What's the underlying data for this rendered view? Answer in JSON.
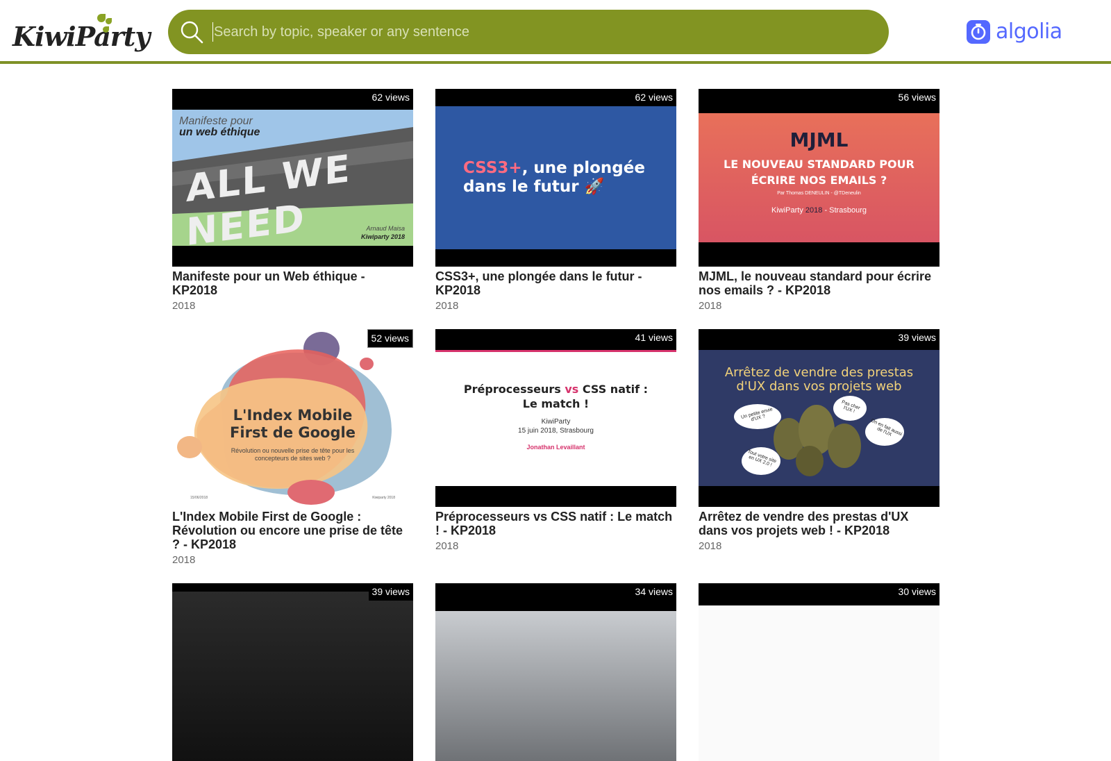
{
  "header": {
    "logo_text": "KiwiParty",
    "search_placeholder": "Search by topic, speaker or any sentence",
    "search_value": "",
    "brand_text": "algolia"
  },
  "colors": {
    "accent": "#829422",
    "algolia": "#5468ff"
  },
  "videos": [
    {
      "views": "62 views",
      "title": "Manifeste pour un Web éthique - KP2018",
      "year": "2018",
      "slide": {
        "line1": "Manifeste pour",
        "line2": "un web éthique",
        "wall": "ALL WE NEED",
        "author": "Arnaud Maisa",
        "event": "Kiwiparty 2018"
      }
    },
    {
      "views": "62 views",
      "title": "CSS3+, une plongée dans le futur - KP2018",
      "year": "2018",
      "slide": {
        "hl": "CSS3+",
        "rest1": ", une plongée",
        "line2": "dans le futur 🚀"
      }
    },
    {
      "views": "56 views",
      "title": "MJML, le nouveau standard pour écrire nos emails ? - KP2018",
      "year": "2018",
      "slide": {
        "head": "MJML",
        "sub1": "LE NOUVEAU STANDARD POUR",
        "sub2": "ÉCRIRE NOS EMAILS ?",
        "by": "Par Thomas DENEULIN - @TDeneulin",
        "event_a": "KiwiParty ",
        "event_b": "2018",
        "event_c": " - Strasbourg"
      }
    },
    {
      "views": "52 views",
      "title": "L'Index Mobile First de Google : Révolution ou encore une prise de tête ? - KP2018",
      "year": "2018",
      "slide": {
        "line1": "L'Index Mobile",
        "line2": "First de Google",
        "sub1": "Révolution ou nouvelle prise de tête pour les",
        "sub2": "concepteurs de sites web ?",
        "date": "15/06/2018",
        "event": "Kiwiparty 2018"
      }
    },
    {
      "views": "41 views",
      "title": "Préprocesseurs vs CSS natif : Le match ! - KP2018",
      "year": "2018",
      "slide": {
        "a": "Préprocesseurs ",
        "vs": "vs",
        "b": " CSS natif :",
        "line2": "Le match !",
        "event": "KiwiParty",
        "date": "15 juin 2018, Strasbourg",
        "author": "Jonathan Levaillant"
      }
    },
    {
      "views": "39 views",
      "title": "Arrêtez de vendre des prestas d'UX dans vos projets web ! - KP2018",
      "year": "2018",
      "slide": {
        "line1": "Arrêtez de vendre des prestas",
        "line2": "d'UX dans vos projets web",
        "b1": "Un petite envie d'UX ?",
        "b2": "Pas cher l'UX !",
        "b3": "On en fait aussi de l'UX",
        "b4": "Tout votre site en UX 2.0 !"
      }
    },
    {
      "views": "39 views"
    },
    {
      "views": "34 views"
    },
    {
      "views": "30 views"
    }
  ]
}
